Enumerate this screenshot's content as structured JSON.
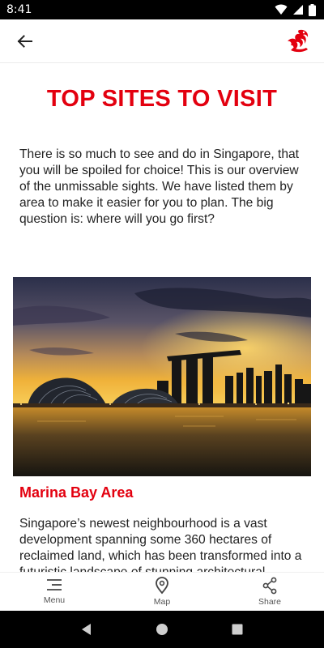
{
  "status_bar": {
    "time": "8:41",
    "icons": [
      "wifi-icon",
      "signal-icon",
      "battery-icon"
    ]
  },
  "app_bar": {
    "back_icon": "arrow-left-icon",
    "logo_icon": "merlion-logo-icon",
    "accent_color": "#e3000f"
  },
  "page": {
    "title": "TOP SITES TO VISIT",
    "intro": "There is so much to see and do in Singapore, that you will be spoiled for choice! This is our overview of the unmissable sights. We have listed them by area to make it easier for you to plan. The big question is: where will you go first?",
    "section": {
      "title": "Marina Bay Area",
      "image": "marina-bay-skyline-photo",
      "body": "Singapore’s newest neighbourhood is a vast development spanning some 360 hectares of reclaimed land, which has been transformed into a futuristic landscape of stunning architectural"
    }
  },
  "bottom_nav": {
    "items": [
      {
        "label": "Menu",
        "icon": "menu-icon"
      },
      {
        "label": "Map",
        "icon": "map-pin-icon"
      },
      {
        "label": "Share",
        "icon": "share-icon"
      }
    ]
  },
  "system_nav": {
    "buttons": [
      "back-triangle-icon",
      "home-circle-icon",
      "recents-square-icon"
    ]
  }
}
